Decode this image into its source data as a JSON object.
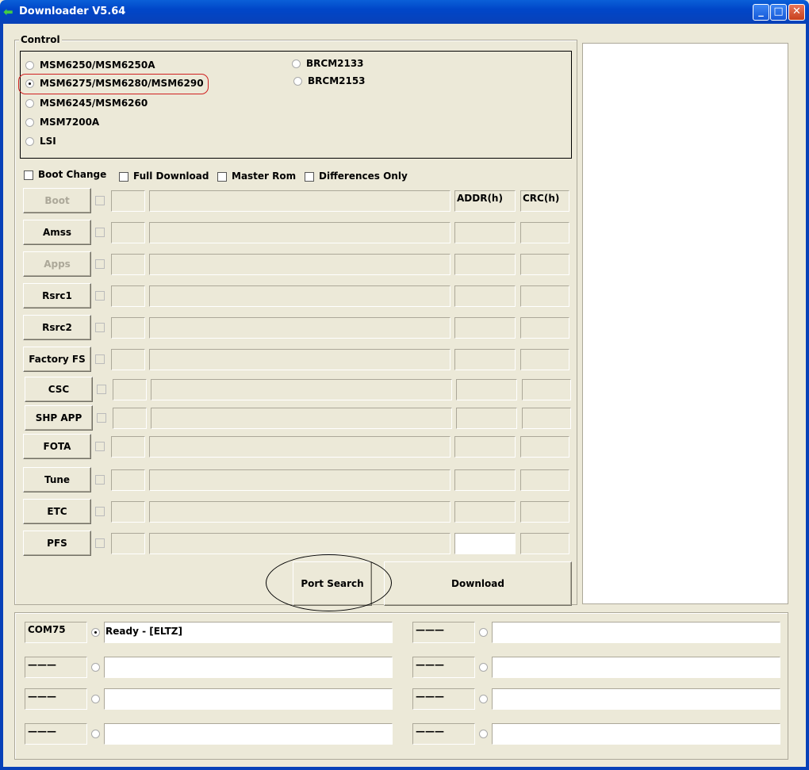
{
  "window": {
    "title": "Downloader V5.64",
    "icons": [
      "app-arrow-icon",
      "minimize-icon",
      "maximize-icon",
      "close-icon"
    ]
  },
  "control": {
    "legend": "Control",
    "chipsets": [
      {
        "label": "MSM6250/MSM6250A",
        "selected": false
      },
      {
        "label": "MSM6275/MSM6280/MSM6290",
        "selected": true
      },
      {
        "label": "MSM6245/MSM6260",
        "selected": false
      },
      {
        "label": "MSM7200A",
        "selected": false
      },
      {
        "label": "LSI",
        "selected": false
      },
      {
        "label": "BRCM2133",
        "selected": false
      },
      {
        "label": "BRCM2153",
        "selected": false
      }
    ],
    "options": [
      {
        "label": "Boot Change",
        "checked": false
      },
      {
        "label": "Full Download",
        "checked": false
      },
      {
        "label": "Master Rom",
        "checked": false
      },
      {
        "label": "Differences Only",
        "checked": false
      }
    ],
    "headers": {
      "addr": "ADDR(h)",
      "crc": "CRC(h)"
    },
    "files": [
      {
        "label": "Boot",
        "enabled": false
      },
      {
        "label": "Amss",
        "enabled": true
      },
      {
        "label": "Apps",
        "enabled": false
      },
      {
        "label": "Rsrc1",
        "enabled": true
      },
      {
        "label": "Rsrc2",
        "enabled": true
      },
      {
        "label": "Factory FS",
        "enabled": true
      },
      {
        "label": "CSC",
        "enabled": true
      },
      {
        "label": "SHP APP",
        "enabled": true
      },
      {
        "label": "FOTA",
        "enabled": true
      },
      {
        "label": "Tune",
        "enabled": true
      },
      {
        "label": "ETC",
        "enabled": true
      },
      {
        "label": "PFS",
        "enabled": true
      }
    ],
    "port_search": "Port Search",
    "download": "Download"
  },
  "ports": [
    {
      "name": "COM75",
      "status": "Ready - [ELTZ]",
      "selected": true
    },
    {
      "name": "———",
      "status": "",
      "selected": false
    },
    {
      "name": "———",
      "status": "",
      "selected": false
    },
    {
      "name": "———",
      "status": "",
      "selected": false
    },
    {
      "name": "———",
      "status": "",
      "selected": false
    },
    {
      "name": "———",
      "status": "",
      "selected": false
    },
    {
      "name": "———",
      "status": "",
      "selected": false
    },
    {
      "name": "———",
      "status": "",
      "selected": false
    }
  ],
  "colors": {
    "highlight_red": "#d02020",
    "titlebar": "#0054e3"
  }
}
